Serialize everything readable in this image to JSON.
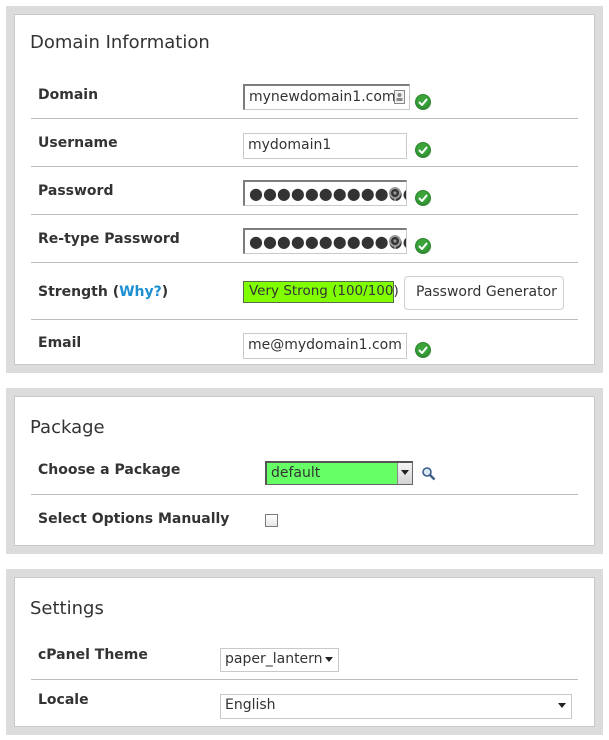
{
  "domain_info": {
    "title": "Domain Information",
    "domain_label": "Domain",
    "domain_value": "mynewdomain1.com",
    "username_label": "Username",
    "username_value": "mydomain1",
    "password_label": "Password",
    "password_value": "●●●●●●●●●●●●",
    "retype_label": "Re-type Password",
    "retype_value": "●●●●●●●●●●●●",
    "strength_label": "Strength (",
    "strength_why": "Why?",
    "strength_close": ")",
    "strength_value": "Very Strong (100/100)",
    "password_generator": "Password Generator",
    "email_label": "Email",
    "email_value": "me@mydomain1.com"
  },
  "package": {
    "title": "Package",
    "choose_label": "Choose a Package",
    "choose_value": "default",
    "manual_label": "Select Options Manually",
    "manual_checked": false
  },
  "settings": {
    "title": "Settings",
    "theme_label": "cPanel Theme",
    "theme_value": "paper_lantern",
    "locale_label": "Locale",
    "locale_value": "English"
  },
  "icons": {
    "valid": "check-circle-icon",
    "contact": "contact-card-icon",
    "key": "key-icon",
    "search": "magnifier-icon"
  },
  "colors": {
    "valid_green": "#3aa33a",
    "strength_bg": "#80ff00",
    "package_bg": "#66ff66",
    "link": "#1b8fd2"
  }
}
